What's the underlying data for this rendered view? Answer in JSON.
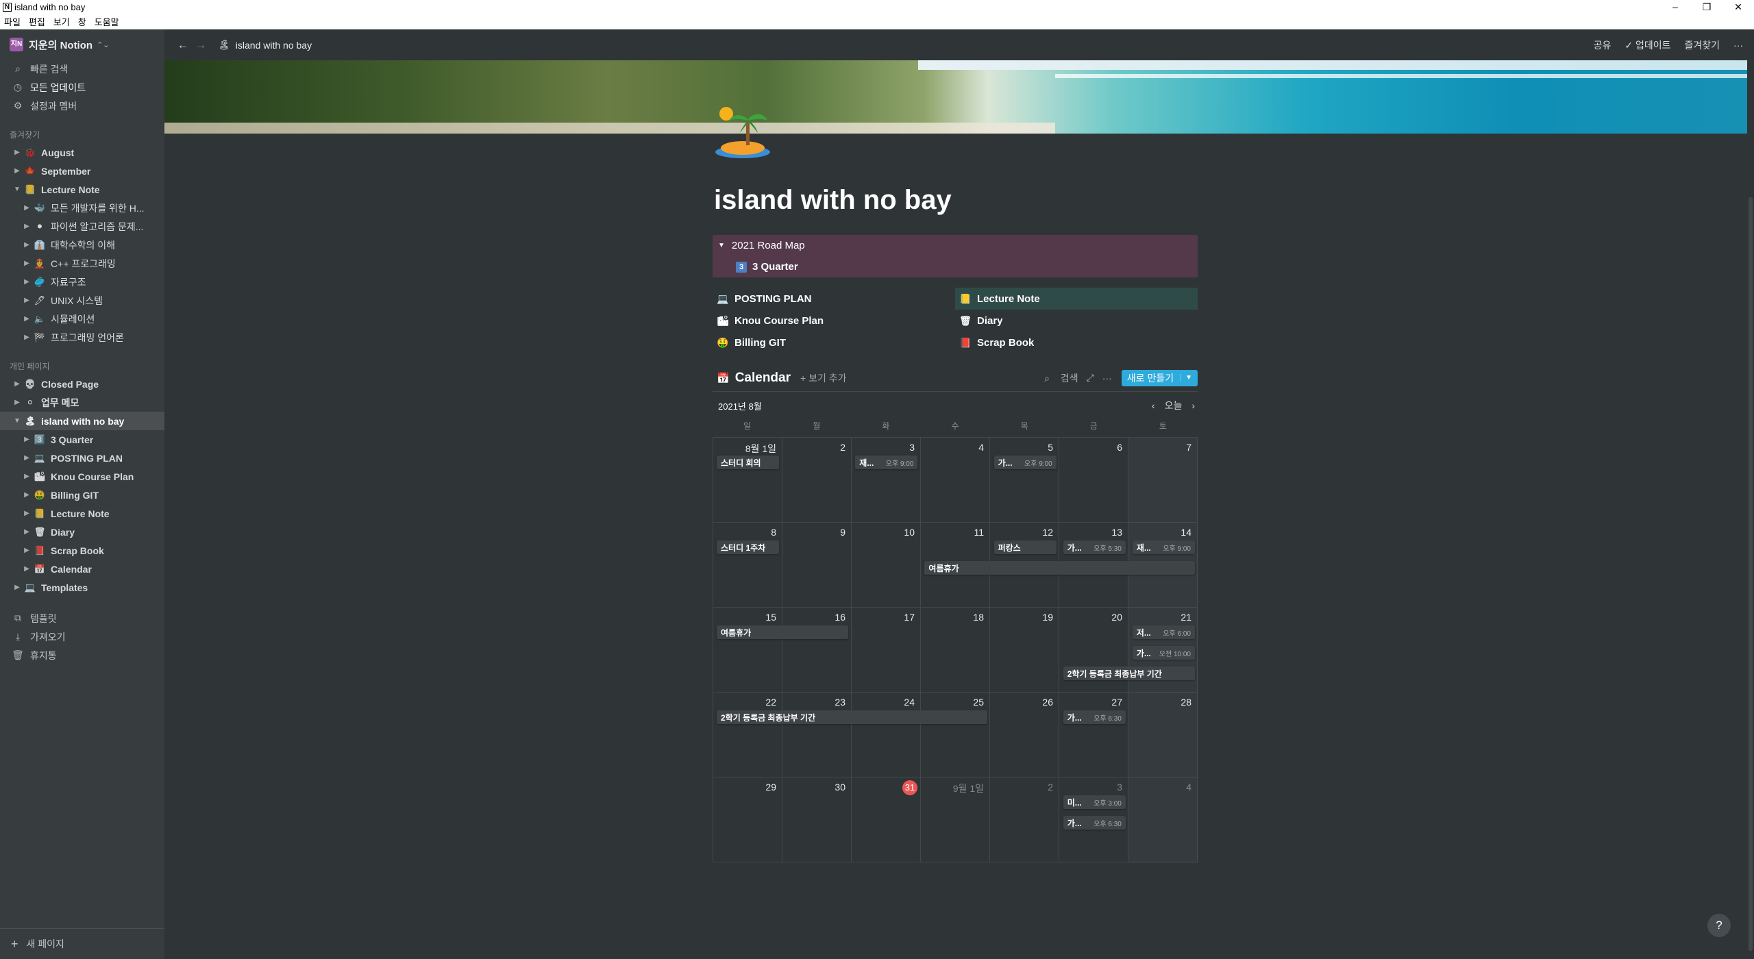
{
  "window": {
    "title": "island with no bay",
    "controls": [
      "–",
      "❐",
      "✕"
    ]
  },
  "menubar": [
    "파일",
    "편집",
    "보기",
    "창",
    "도움말"
  ],
  "sidebar": {
    "workspace": "지운의 Notion",
    "workspace_initials": "지N",
    "quick": [
      {
        "label": "빠른 검색",
        "icon": "search-icon"
      },
      {
        "label": "모든 업데이트",
        "icon": "clock-icon"
      },
      {
        "label": "설정과 멤버",
        "icon": "gear-icon"
      }
    ],
    "favorites_title": "즐겨찾기",
    "favorites": [
      {
        "label": "August",
        "emoji": "🐞",
        "open": false,
        "level": 0
      },
      {
        "label": "September",
        "emoji": "🍁",
        "open": false,
        "level": 0
      },
      {
        "label": "Lecture Note",
        "emoji": "📒",
        "open": true,
        "level": 0
      },
      {
        "label": "모든 개발자를 위한 H...",
        "emoji": "🐳",
        "level": 1
      },
      {
        "label": "파이썬 알고리즘 문제...",
        "emoji": "⚫",
        "level": 1
      },
      {
        "label": "대학수학의 이해",
        "emoji": "👔",
        "level": 1
      },
      {
        "label": "C++ 프로그래밍",
        "emoji": "👲",
        "level": 1
      },
      {
        "label": "자료구조",
        "emoji": "🥏",
        "level": 1
      },
      {
        "label": "UNIX 시스템",
        "emoji": "🖊",
        "level": 1
      },
      {
        "label": "시뮬레이션",
        "emoji": "🔈",
        "level": 1
      },
      {
        "label": "프로그래밍 언어론",
        "emoji": "🏁",
        "level": 1
      }
    ],
    "private_title": "개인 페이지",
    "private": [
      {
        "label": "Closed Page",
        "emoji": "💀",
        "level": 0
      },
      {
        "label": "업무 메모",
        "emoji": "⚪",
        "level": 0
      },
      {
        "label": "island with no bay",
        "emoji": "🏝",
        "level": 0,
        "open": true,
        "active": true
      },
      {
        "label": "3 Quarter",
        "emoji": "3️⃣",
        "level": 1
      },
      {
        "label": "POSTING PLAN",
        "emoji": "💻",
        "level": 1
      },
      {
        "label": "Knou Course Plan",
        "emoji": "🏙",
        "level": 1
      },
      {
        "label": "Billing GIT",
        "emoji": "🤑",
        "level": 1
      },
      {
        "label": "Lecture Note",
        "emoji": "📒",
        "level": 1
      },
      {
        "label": "Diary",
        "emoji": "🗑",
        "level": 1
      },
      {
        "label": "Scrap Book",
        "emoji": "📕",
        "level": 1
      },
      {
        "label": "Calendar",
        "emoji": "📅",
        "level": 1
      },
      {
        "label": "Templates",
        "emoji": "💻",
        "level": 0
      }
    ],
    "bottom_links": [
      {
        "label": "템플릿",
        "icon": "template-icon"
      },
      {
        "label": "가져오기",
        "icon": "import-icon"
      },
      {
        "label": "휴지통",
        "icon": "trash-icon"
      }
    ],
    "new_page": "새 페이지"
  },
  "topbar": {
    "breadcrumb": "island with no bay",
    "breadcrumb_emoji": "🏝",
    "share": "공유",
    "updates": "✓ 업데이트",
    "favorite": "즐겨찾기",
    "more": "···"
  },
  "page": {
    "icon": "island-icon",
    "title": "island with no bay",
    "toggle": {
      "label": "2021 Road Map",
      "child_badge": "3",
      "child_label": "3 Quarter"
    },
    "links": [
      [
        {
          "label": "POSTING PLAN",
          "emoji": "💻"
        },
        {
          "label": "Lecture Note",
          "emoji": "📒",
          "highlight": true
        }
      ],
      [
        {
          "label": "Knou Course Plan",
          "emoji": "🏙"
        },
        {
          "label": "Diary",
          "emoji": "🗑"
        }
      ],
      [
        {
          "label": "Billing GIT",
          "emoji": "🤑"
        },
        {
          "label": "Scrap Book",
          "emoji": "📕"
        }
      ]
    ]
  },
  "calendar": {
    "title": "Calendar",
    "emoji": "📅",
    "add_view": "+ 보기 추가",
    "search": "검색",
    "expand": "⤢",
    "more": "···",
    "new_button": "새로 만들기",
    "month": "2021년 8월",
    "today_label": "오늘",
    "weekdays": [
      "일",
      "월",
      "화",
      "수",
      "목",
      "금",
      "토"
    ],
    "weeks": [
      [
        "8월 1일",
        "2",
        "3",
        "4",
        "5",
        "6",
        "7"
      ],
      [
        "8",
        "9",
        "10",
        "11",
        "12",
        "13",
        "14"
      ],
      [
        "15",
        "16",
        "17",
        "18",
        "19",
        "20",
        "21"
      ],
      [
        "22",
        "23",
        "24",
        "25",
        "26",
        "27",
        "28"
      ],
      [
        "29",
        "30",
        "31",
        "9월 1일",
        "2",
        "3",
        "4"
      ]
    ],
    "today": "31",
    "events": [
      {
        "week": 0,
        "day": 0,
        "span": 1,
        "slot": 0,
        "title": "스터디 회의",
        "time": ""
      },
      {
        "week": 0,
        "day": 2,
        "span": 1,
        "slot": 0,
        "title": "재...",
        "time": "오후 9:00"
      },
      {
        "week": 0,
        "day": 4,
        "span": 1,
        "slot": 0,
        "title": "가...",
        "time": "오후 9:00"
      },
      {
        "week": 1,
        "day": 0,
        "span": 1,
        "slot": 0,
        "title": "스터디 1주차",
        "time": ""
      },
      {
        "week": 1,
        "day": 4,
        "span": 1,
        "slot": 0,
        "title": "퍼캉스",
        "time": ""
      },
      {
        "week": 1,
        "day": 5,
        "span": 1,
        "slot": 0,
        "title": "가...",
        "time": "오후 5:30"
      },
      {
        "week": 1,
        "day": 6,
        "span": 1,
        "slot": 0,
        "title": "재...",
        "time": "오후 9:00"
      },
      {
        "week": 1,
        "day": 3,
        "span": 4,
        "slot": 1,
        "title": "여름휴가",
        "time": ""
      },
      {
        "week": 2,
        "day": 0,
        "span": 2,
        "slot": 0,
        "title": "여름휴가",
        "time": ""
      },
      {
        "week": 2,
        "day": 6,
        "span": 1,
        "slot": 0,
        "title": "저...",
        "time": "오후 6:00"
      },
      {
        "week": 2,
        "day": 6,
        "span": 1,
        "slot": 1,
        "title": "가...",
        "time": "오전 10:00"
      },
      {
        "week": 2,
        "day": 5,
        "span": 2,
        "slot": 2,
        "title": "2학기 등록금 최종납부 기간",
        "time": ""
      },
      {
        "week": 3,
        "day": 0,
        "span": 4,
        "slot": 0,
        "title": "2학기 등록금 최종납부 기간",
        "time": ""
      },
      {
        "week": 3,
        "day": 5,
        "span": 1,
        "slot": 0,
        "title": "가...",
        "time": "오후 6:30"
      },
      {
        "week": 4,
        "day": 5,
        "span": 1,
        "slot": 0,
        "title": "미...",
        "time": "오후 3:00"
      },
      {
        "week": 4,
        "day": 5,
        "span": 1,
        "slot": 1,
        "title": "가...",
        "time": "오후 6:30"
      }
    ]
  },
  "help": "?"
}
